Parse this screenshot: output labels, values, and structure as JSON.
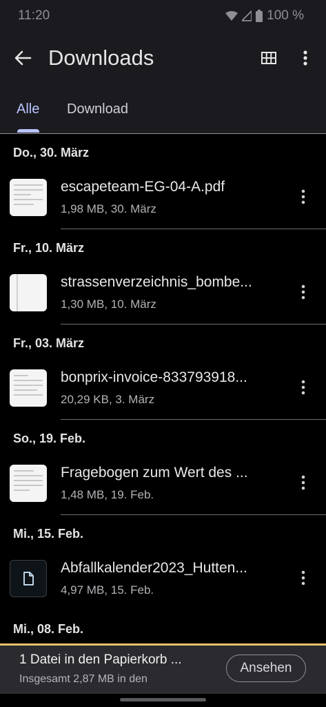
{
  "status": {
    "time": "11:20",
    "battery": "100 %"
  },
  "appbar": {
    "title": "Downloads",
    "back_icon": "arrow-back-icon",
    "grid_icon": "grid-view-icon",
    "more_icon": "more-vert-icon"
  },
  "tabs": {
    "all": "Alle",
    "download": "Download"
  },
  "sections": [
    {
      "date": "Do., 30. März",
      "item": {
        "name": "escapeteam-EG-04-A.pdf",
        "meta": "1,98 MB, 30. März"
      }
    },
    {
      "date": "Fr., 10. März",
      "item": {
        "name": "strassenverzeichnis_bombe...",
        "meta": "1,30 MB, 10. März"
      }
    },
    {
      "date": "Fr., 03. März",
      "item": {
        "name": "bonprix-invoice-833793918...",
        "meta": "20,29 KB, 3. März"
      }
    },
    {
      "date": "So., 19. Feb.",
      "item": {
        "name": "Fragebogen zum Wert des ...",
        "meta": "1,48 MB, 19. Feb."
      }
    },
    {
      "date": "Mi., 15. Feb.",
      "item": {
        "name": "Abfallkalender2023_Hutten...",
        "meta": "4,97 MB, 15. Feb."
      }
    },
    {
      "date": "Mi., 08. Feb."
    }
  ],
  "snackbar": {
    "title": "1 Datei in den Papierkorb ...",
    "subtitle": "Insgesamt 2,87 MB in den",
    "action": "Ansehen"
  },
  "colors": {
    "accent": "#b9c3ff",
    "snackbar_border": "#e9c46a"
  }
}
